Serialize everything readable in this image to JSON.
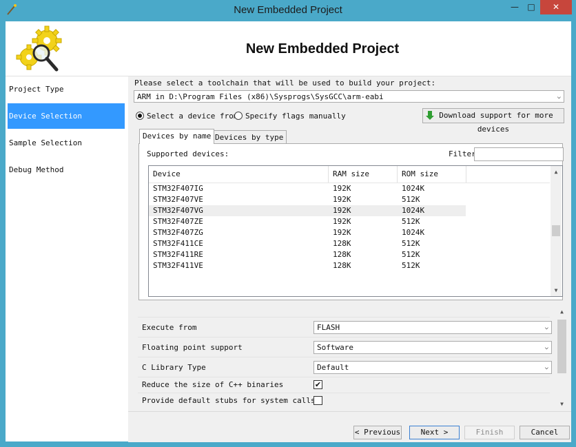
{
  "window": {
    "title": "New Embedded Project"
  },
  "titlebar": {
    "minimize": "—",
    "maximize": "□",
    "close": "✕"
  },
  "header": {
    "title": "New Embedded Project",
    "logo_icon": "gears-magnifier-icon"
  },
  "sidebar": {
    "items": [
      {
        "label": "Project Type",
        "active": false
      },
      {
        "label": "Device Selection",
        "active": true
      },
      {
        "label": "Sample Selection",
        "active": false
      },
      {
        "label": "Debug Method",
        "active": false
      }
    ]
  },
  "toolchain": {
    "prompt": "Please select a toolchain that will be used to build your project:",
    "selected": "ARM in D:\\Program Files (x86)\\Sysprogs\\SysGCC\\arm-eabi"
  },
  "mode": {
    "option1": "Select a device from",
    "option2": "Specify flags manually",
    "selected": "option1"
  },
  "download_button": "Download support for more devices",
  "tabs": [
    {
      "label": "Devices by name",
      "active": true
    },
    {
      "label": "Devices by type",
      "active": false
    }
  ],
  "devices": {
    "supported_label": "Supported devices:",
    "filter_label": "Filter",
    "filter_value": "",
    "columns": [
      "Device",
      "RAM size",
      "ROM size"
    ],
    "rows": [
      [
        "STM32F407IG",
        "192K",
        "1024K"
      ],
      [
        "STM32F407VE",
        "192K",
        "512K"
      ],
      [
        "STM32F407VG",
        "192K",
        "1024K"
      ],
      [
        "STM32F407ZE",
        "192K",
        "512K"
      ],
      [
        "STM32F407ZG",
        "192K",
        "1024K"
      ],
      [
        "STM32F411CE",
        "128K",
        "512K"
      ],
      [
        "STM32F411RE",
        "128K",
        "512K"
      ],
      [
        "STM32F411VE",
        "128K",
        "512K"
      ]
    ],
    "selected_row": 2
  },
  "properties": [
    {
      "label": "Execute from",
      "type": "select",
      "value": "FLASH"
    },
    {
      "label": "Floating point support",
      "type": "select",
      "value": "Software"
    },
    {
      "label": "C Library Type",
      "type": "select",
      "value": "Default"
    },
    {
      "label": "Reduce the size of C++ binaries",
      "type": "checkbox",
      "checked": true
    },
    {
      "label": "Provide default stubs for system calls",
      "type": "checkbox",
      "checked": false
    }
  ],
  "footer": {
    "previous": "< Previous",
    "next": "Next >",
    "finish": "Finish",
    "cancel": "Cancel"
  },
  "colors": {
    "accent": "#3399ff",
    "titlebar": "#4aa9c9",
    "close": "#c7463c"
  }
}
